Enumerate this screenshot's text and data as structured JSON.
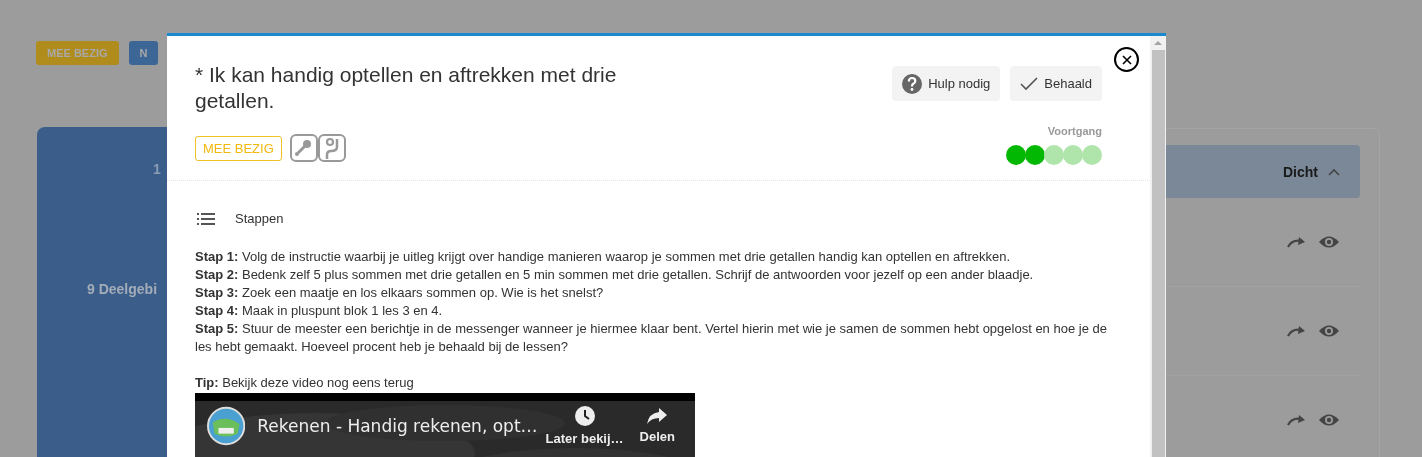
{
  "background": {
    "badges": [
      {
        "label": "MEE BEZIG",
        "kind": "doing"
      },
      {
        "label": "N",
        "kind": "new"
      }
    ],
    "card": {
      "number": "1",
      "text": "9 Deelgebi"
    },
    "panel": {
      "header": "Dicht",
      "expanded": true,
      "rows": [
        {
          "kind": "item"
        },
        {
          "kind": "item"
        },
        {
          "kind": "item"
        }
      ]
    }
  },
  "modal": {
    "title": "* Ik kan handig optellen en aftrekken met drie getallen.",
    "status": "MEE BEZIG",
    "buttons": [
      {
        "label": "Hulp nodig",
        "kind": "help"
      },
      {
        "label": "Behaald",
        "kind": "done"
      }
    ],
    "progress": {
      "label": "Voortgang",
      "dots": [
        {
          "filled": true
        },
        {
          "filled": true
        },
        {
          "filled": false
        },
        {
          "filled": false
        },
        {
          "filled": false
        }
      ]
    },
    "section": "Stappen",
    "steps": [
      {
        "label": "Stap 1:",
        "text": "Volg de instructie waarbij je uitleg krijgt over handige manieren waarop je sommen met drie getallen handig kan optellen en aftrekken."
      },
      {
        "label": "Stap 2:",
        "text": "Bedenk zelf 5 plus sommen met drie getallen en 5 min sommen met drie getallen. Schrijf de antwoorden voor jezelf op een ander blaadje."
      },
      {
        "label": "Stap 3:",
        "text": "Zoek een maatje en los elkaars sommen op. Wie is het snelst?"
      },
      {
        "label": "Stap 4:",
        "text": "Maak in pluspunt blok 1 les 3 en 4."
      },
      {
        "label": "Stap 5:",
        "text": "Stuur de meester een berichtje in de messenger wanneer je hiermee klaar bent. Vertel hierin met wie je samen de sommen hebt opgelost en hoe je de les hebt gemaakt. Hoeveel procent heb je behaald bij de lessen?"
      }
    ],
    "tip": {
      "label": "Tip:",
      "text": "Bekijk deze video nog eens terug"
    },
    "video": {
      "title": "Rekenen - Handig rekenen, opt…",
      "actions": [
        {
          "label": "Later bekij…",
          "kind": "later"
        },
        {
          "label": "Delen",
          "kind": "share"
        }
      ]
    }
  }
}
